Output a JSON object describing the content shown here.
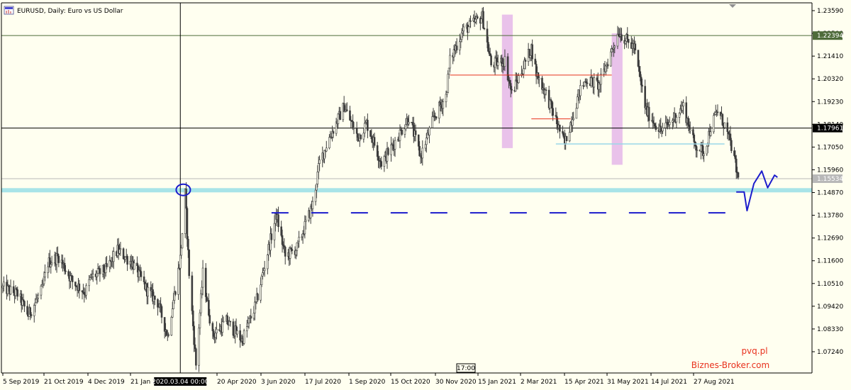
{
  "window": {
    "title": "EURUSD, Daily:  Euro vs US Dollar",
    "icon": "chart-window-icon"
  },
  "chart_data": {
    "type": "candlestick",
    "symbol": "EURUSD",
    "timeframe": "Daily",
    "description": "Euro vs US Dollar",
    "ylim": [
      1.066,
      1.239
    ],
    "y_ticks": [
      "1.23590",
      "1.22500",
      "1.21410",
      "1.20320",
      "1.19230",
      "1.18140",
      "1.17050",
      "1.15960",
      "1.14870",
      "1.13780",
      "1.12690",
      "1.11600",
      "1.10510",
      "1.09420",
      "1.08330",
      "1.07240"
    ],
    "x_ticks": [
      "5 Sep 2019",
      "21 Oct 2019",
      "4 Dec 2019",
      "21 Jan 2020",
      "20 Apr 2020",
      "3 Jun 2020",
      "17 Jul 2020",
      "1 Sep 2020",
      "15 Oct 2020",
      "30 Nov 2020",
      "15 Jan 2021",
      "2 Mar 2021",
      "15 Apr 2021",
      "31 May 2021",
      "14 Jul 2021",
      "27 Aug 2021"
    ],
    "x_range": [
      "2019-09-05",
      "2021-09-24"
    ],
    "price_path": [
      [
        "2019-09-05",
        1.103
      ],
      [
        "2019-09-20",
        1.1
      ],
      [
        "2019-10-01",
        1.09
      ],
      [
        "2019-10-15",
        1.102
      ],
      [
        "2019-10-21",
        1.115
      ],
      [
        "2019-11-01",
        1.118
      ],
      [
        "2019-11-15",
        1.106
      ],
      [
        "2019-11-28",
        1.101
      ],
      [
        "2019-12-04",
        1.108
      ],
      [
        "2019-12-20",
        1.112
      ],
      [
        "2019-12-31",
        1.121
      ],
      [
        "2020-01-15",
        1.115
      ],
      [
        "2020-01-30",
        1.102
      ],
      [
        "2020-02-10",
        1.096
      ],
      [
        "2020-02-20",
        1.08
      ],
      [
        "2020-03-04",
        1.117
      ],
      [
        "2020-03-09",
        1.148
      ],
      [
        "2020-03-13",
        1.11
      ],
      [
        "2020-03-20",
        1.066
      ],
      [
        "2020-03-27",
        1.11
      ],
      [
        "2020-04-06",
        1.08
      ],
      [
        "2020-04-20",
        1.087
      ],
      [
        "2020-05-06",
        1.078
      ],
      [
        "2020-05-20",
        1.095
      ],
      [
        "2020-06-03",
        1.124
      ],
      [
        "2020-06-10",
        1.138
      ],
      [
        "2020-06-19",
        1.118
      ],
      [
        "2020-07-01",
        1.122
      ],
      [
        "2020-07-17",
        1.143
      ],
      [
        "2020-07-24",
        1.163
      ],
      [
        "2020-08-03",
        1.175
      ],
      [
        "2020-08-18",
        1.19
      ],
      [
        "2020-09-01",
        1.175
      ],
      [
        "2020-09-10",
        1.182
      ],
      [
        "2020-09-25",
        1.163
      ],
      [
        "2020-10-05",
        1.17
      ],
      [
        "2020-10-15",
        1.178
      ],
      [
        "2020-10-23",
        1.185
      ],
      [
        "2020-11-04",
        1.166
      ],
      [
        "2020-11-18",
        1.185
      ],
      [
        "2020-11-30",
        1.195
      ],
      [
        "2020-12-04",
        1.212
      ],
      [
        "2020-12-17",
        1.226
      ],
      [
        "2021-01-06",
        1.233
      ],
      [
        "2021-01-15",
        1.21
      ],
      [
        "2021-01-29",
        1.212
      ],
      [
        "2021-02-05",
        1.196
      ],
      [
        "2021-02-25",
        1.218
      ],
      [
        "2021-03-02",
        1.206
      ],
      [
        "2021-03-12",
        1.196
      ],
      [
        "2021-03-31",
        1.172
      ],
      [
        "2021-04-15",
        1.197
      ],
      [
        "2021-04-22",
        1.203
      ],
      [
        "2021-05-05",
        1.2
      ],
      [
        "2021-05-25",
        1.226
      ],
      [
        "2021-06-01",
        1.222
      ],
      [
        "2021-06-10",
        1.218
      ],
      [
        "2021-06-22",
        1.188
      ],
      [
        "2021-07-07",
        1.178
      ],
      [
        "2021-07-14",
        1.181
      ],
      [
        "2021-07-30",
        1.19
      ],
      [
        "2021-08-10",
        1.172
      ],
      [
        "2021-08-20",
        1.168
      ],
      [
        "2021-08-27",
        1.18
      ],
      [
        "2021-09-03",
        1.188
      ],
      [
        "2021-09-10",
        1.181
      ],
      [
        "2021-09-17",
        1.171
      ],
      [
        "2021-09-24",
        1.155
      ]
    ],
    "price_labels": [
      {
        "text": "1.22394",
        "value": 1.22394,
        "bg": "#4e6b3a",
        "fg": "#ffffff"
      },
      {
        "text": "1.17961",
        "value": 1.17961,
        "bg": "#000000",
        "fg": "#ffffff"
      },
      {
        "text": "1.15534",
        "value": 1.15534,
        "bg": "#b8b8b8",
        "fg": "#ffffff"
      }
    ],
    "horizontal_lines": [
      {
        "value": 1.22394,
        "color": "#4e6b3a"
      },
      {
        "value": 1.17961,
        "color": "#000000"
      },
      {
        "value": 1.15534,
        "color": "#b8b8b8"
      }
    ],
    "support_zone": {
      "value": 1.1498,
      "color": "#a8e4e8"
    },
    "crosshair": {
      "date": "2020-03-04",
      "value": 1.17961,
      "label": "2020.03.04 00:00"
    },
    "crosshair_time_label": "17:00",
    "drawings": [
      {
        "kind": "dashed_level",
        "value": 1.139,
        "from": "2020-06-05",
        "to": "2021-09-28",
        "color": "#1c1ccc"
      },
      {
        "kind": "circle",
        "date": "2020-03-07",
        "value": 1.15,
        "color": "#1c1ccc"
      },
      {
        "kind": "red_level",
        "value": 1.205,
        "from": "2020-12-04",
        "to": "2021-05-18",
        "color": "#e8321e"
      },
      {
        "kind": "red_level",
        "value": 1.184,
        "from": "2021-02-25",
        "to": "2021-04-06",
        "color": "#e8321e"
      },
      {
        "kind": "lightblue_level",
        "value": 1.172,
        "from": "2021-03-22",
        "to": "2021-09-10",
        "color": "#9ad7e8"
      },
      {
        "kind": "purple_zone",
        "from": "2021-01-26",
        "to": "2021-02-06",
        "top": 1.234,
        "bottom": 1.17,
        "color": "#e9c2ea"
      },
      {
        "kind": "purple_zone",
        "from": "2021-05-18",
        "to": "2021-05-29",
        "top": 1.225,
        "bottom": 1.162,
        "color": "#e9c2ea"
      }
    ],
    "forecast_path": [
      [
        "2021-09-22",
        1.149
      ],
      [
        "2021-09-30",
        1.149
      ],
      [
        "2021-10-03",
        1.14
      ],
      [
        "2021-10-10",
        1.153
      ],
      [
        "2021-10-18",
        1.159
      ],
      [
        "2021-10-24",
        1.151
      ],
      [
        "2021-10-31",
        1.157
      ],
      [
        "2021-11-03",
        1.156
      ]
    ],
    "colors": {
      "background": "#fffff0",
      "candles": "#3c3c3c",
      "axis": "#000000"
    }
  },
  "watermark": {
    "line1": "pvq.pl",
    "line2": "Biznes-Broker.com"
  }
}
